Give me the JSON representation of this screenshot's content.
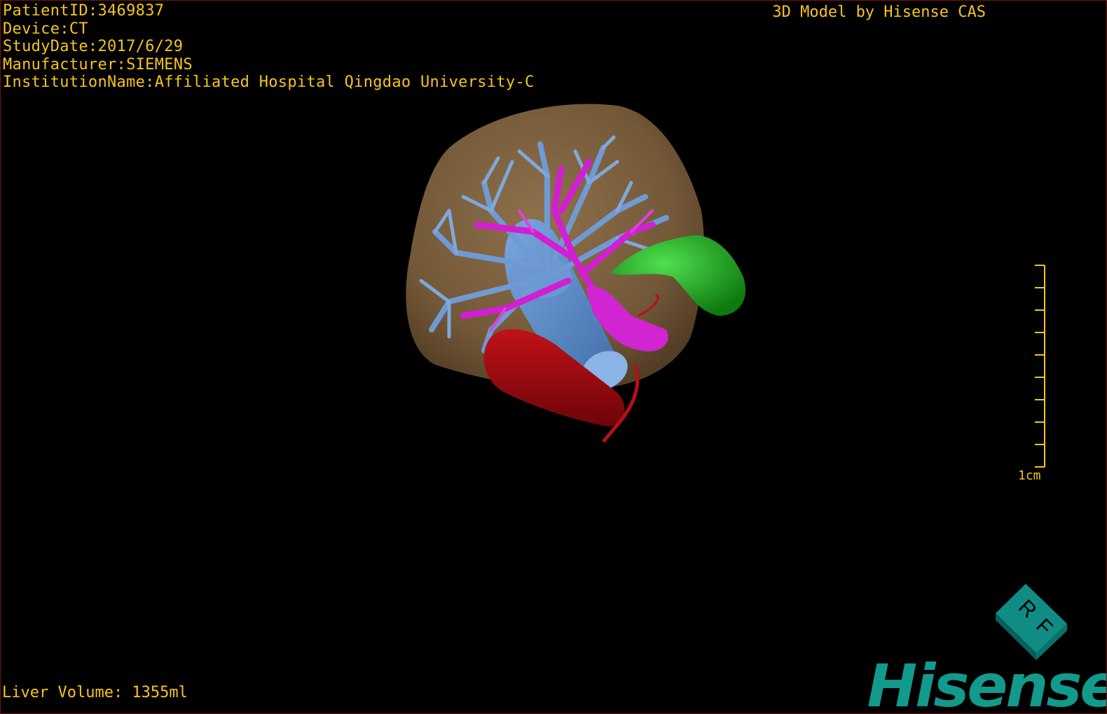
{
  "overlay": {
    "patient_id": "PatientID:3469837",
    "device": "Device:CT",
    "study_date": "StudyDate:2017/6/29",
    "manufacturer": "Manufacturer:SIEMENS",
    "institution": "InstitutionName:Affiliated Hospital Qingdao University-C",
    "watermark": "3D Model by Hisense CAS",
    "liver_volume": "Liver Volume: 1355ml"
  },
  "scale_bar": {
    "label": "1cm"
  },
  "orientation_cube": {
    "face_labels": [
      "R",
      "F"
    ]
  },
  "brand": {
    "logo_text": "Hisense"
  },
  "colors": {
    "overlay_text": "#f5c518",
    "liver": "#8a6a44",
    "portal_vein": "#5f8fc9",
    "hepatic_artery": "#d21fd2",
    "aorta": "#a50d12",
    "gallbladder": "#1fb51f",
    "cube": "#0f8c84",
    "brand": "#129a8c"
  },
  "icons": {
    "orientation": "orientation-cube-icon",
    "ruler": "scale-ruler-icon"
  }
}
